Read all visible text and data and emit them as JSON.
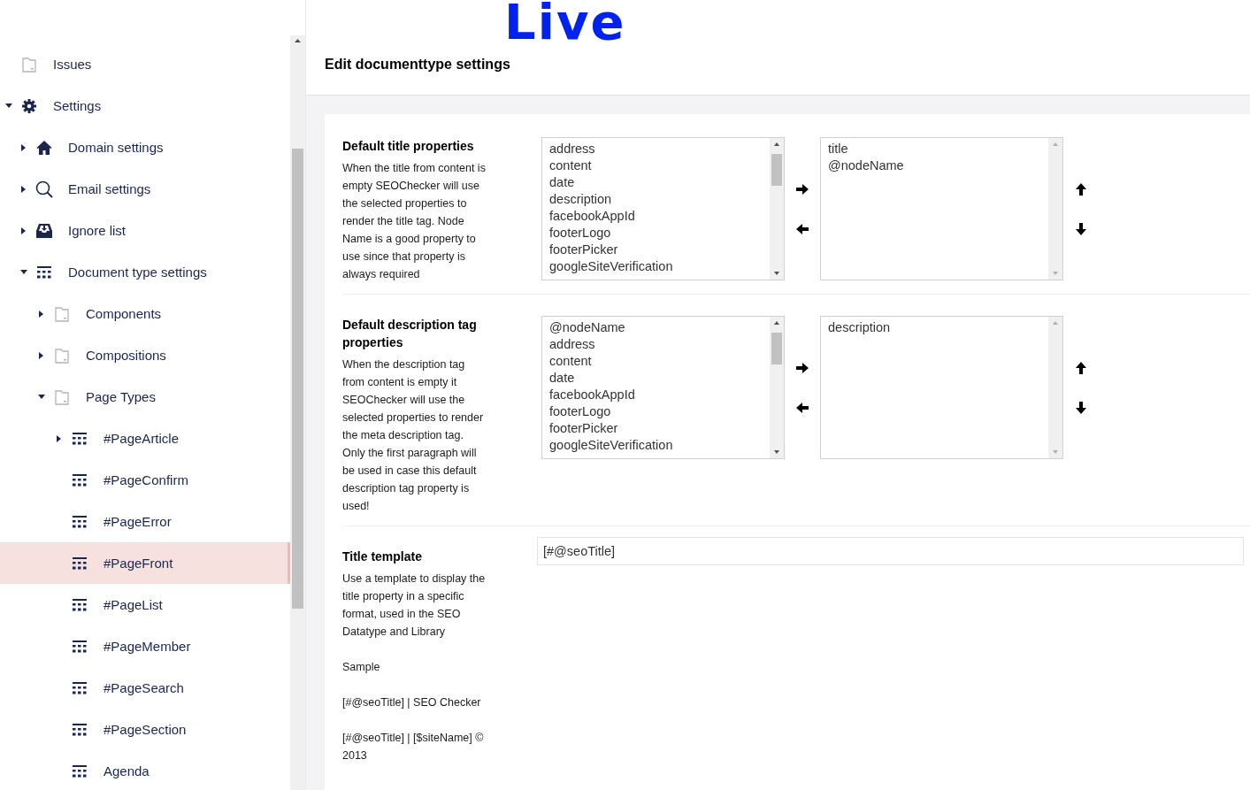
{
  "sidebar": {
    "items": [
      {
        "label": "Issues",
        "kind": "folder",
        "selected": false
      },
      {
        "label": "Settings",
        "kind": "gear",
        "selected": false,
        "expanded": true,
        "children": [
          {
            "label": "Domain settings",
            "kind": "home",
            "selected": false,
            "expanded": false
          },
          {
            "label": "Email settings",
            "kind": "search",
            "selected": false,
            "expanded": false
          },
          {
            "label": "Ignore list",
            "kind": "inbox",
            "selected": false,
            "expanded": false
          },
          {
            "label": "Document type settings",
            "kind": "grid",
            "selected": false,
            "expanded": true,
            "children": [
              {
                "label": "Components",
                "kind": "folder",
                "selected": false,
                "expanded": false
              },
              {
                "label": "Compositions",
                "kind": "folder",
                "selected": false,
                "expanded": false
              },
              {
                "label": "Page Types",
                "kind": "folder",
                "selected": false,
                "expanded": true,
                "children": [
                  {
                    "label": "#PageArticle",
                    "kind": "grid",
                    "selected": false,
                    "expanded": false
                  },
                  {
                    "label": "#PageConfirm",
                    "kind": "grid",
                    "selected": false
                  },
                  {
                    "label": "#PageError",
                    "kind": "grid",
                    "selected": false
                  },
                  {
                    "label": "#PageFront",
                    "kind": "grid",
                    "selected": true
                  },
                  {
                    "label": "#PageList",
                    "kind": "grid",
                    "selected": false
                  },
                  {
                    "label": "#PageMember",
                    "kind": "grid",
                    "selected": false
                  },
                  {
                    "label": "#PageSearch",
                    "kind": "grid",
                    "selected": false
                  },
                  {
                    "label": "#PageSection",
                    "kind": "grid",
                    "selected": false
                  },
                  {
                    "label": "Agenda",
                    "kind": "grid",
                    "selected": false
                  }
                ]
              }
            ]
          }
        ]
      }
    ]
  },
  "annotation": "Live",
  "header": {
    "title": "Edit documenttype settings"
  },
  "sections": [
    {
      "kind": "picker",
      "title": "Default title properties",
      "description": [
        "When the title from content is empty SEOChecker will use the selected properties to render the title tag. Node Name is a good property to use since that property is always required"
      ],
      "available": [
        "address",
        "content",
        "date",
        "description",
        "facebookAppId",
        "footerLogo",
        "footerPicker",
        "googleSiteVerification"
      ],
      "chosen": [
        "title",
        "@nodeName"
      ]
    },
    {
      "kind": "picker",
      "title": "Default description tag properties",
      "description": [
        "When the description tag from content is empty it SEOChecker will use the selected properties to render the meta description tag. Only the first paragraph will be used in case this default description tag property is used!"
      ],
      "available": [
        "@nodeName",
        "address",
        "content",
        "date",
        "facebookAppId",
        "footerLogo",
        "footerPicker",
        "googleSiteVerification"
      ],
      "chosen": [
        "description"
      ]
    },
    {
      "kind": "text",
      "title": "Title template",
      "description": [
        "Use a template to display the title property in a specific format, used in the SEO Datatype and Library",
        "Sample",
        "[#@seoTitle] | SEO Checker",
        "[#@seoTitle] | [$siteName] © 2013"
      ],
      "value": "[#@seoTitle]"
    }
  ]
}
